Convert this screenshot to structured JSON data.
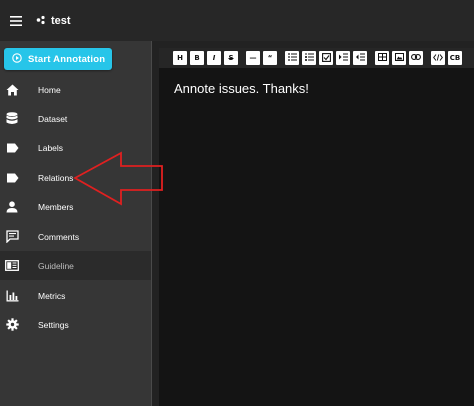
{
  "appbar": {
    "menu_icon": "hamburger-menu-icon",
    "project_icon": "project-dots-icon",
    "project_name": "test"
  },
  "sidebar": {
    "start_button": {
      "label": "Start Annotation",
      "icon": "play-circle-icon",
      "color": "#27c5e9"
    },
    "items": [
      {
        "label": "Home",
        "icon": "home-icon"
      },
      {
        "label": "Dataset",
        "icon": "database-icon"
      },
      {
        "label": "Labels",
        "icon": "label-icon"
      },
      {
        "label": "Relations",
        "icon": "label-icon"
      },
      {
        "label": "Members",
        "icon": "person-icon"
      },
      {
        "label": "Comments",
        "icon": "comment-icon"
      },
      {
        "label": "Guideline",
        "icon": "book-icon",
        "active": true
      },
      {
        "label": "Metrics",
        "icon": "chart-icon"
      },
      {
        "label": "Settings",
        "icon": "gear-icon"
      }
    ]
  },
  "editor": {
    "toolbar": [
      "H",
      "B",
      "I",
      "S",
      "—",
      "“",
      "list",
      "ordered",
      "task",
      "indent",
      "outdent",
      "table",
      "image",
      "link",
      "code",
      "CB"
    ],
    "content": "Annote issues. Thanks!"
  },
  "annotation": {
    "type": "arrow",
    "color": "#e02020",
    "points_to": "Relations"
  }
}
